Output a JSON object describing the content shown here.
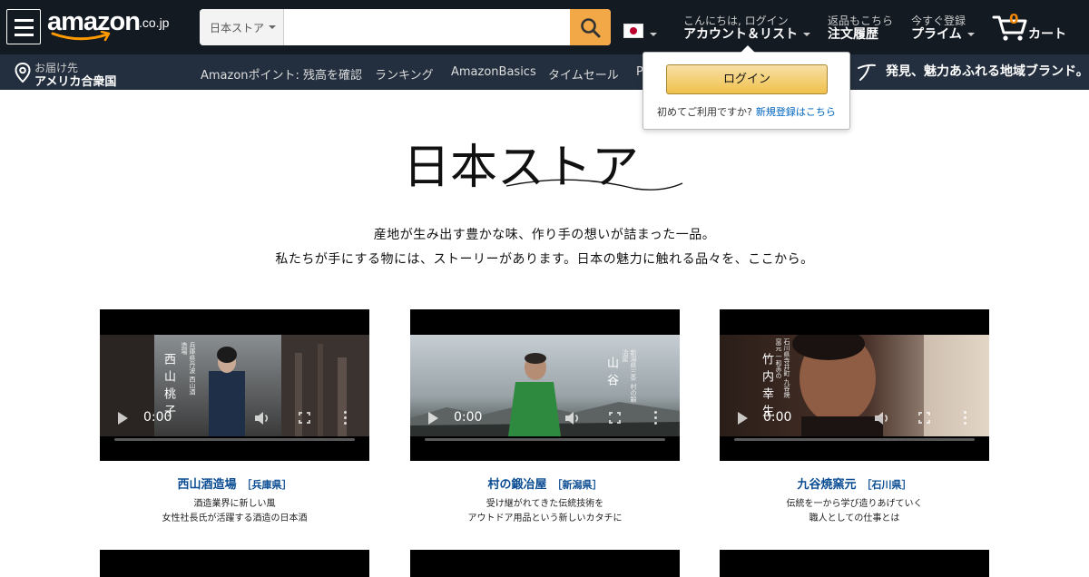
{
  "header": {
    "logo_word": "amazon",
    "logo_suffix": ".co.jp",
    "search": {
      "category": "日本ストア",
      "placeholder": "",
      "value": ""
    },
    "account": {
      "greeting": "こんにちは, ログイン",
      "label": "アカウント＆リスト"
    },
    "orders": {
      "small": "返品もこちら",
      "big": "注文履歴"
    },
    "prime": {
      "small": "今すぐ登録",
      "big": "プライム"
    },
    "cart": {
      "count": "0",
      "label": "カート"
    }
  },
  "subnav": {
    "deliver_small": "お届け先",
    "deliver_big": "アメリカ合衆国",
    "links": [
      "Amazonポイント: 残高を確認",
      "ランキング",
      "AmazonBasics",
      "タイムセール",
      "P"
    ],
    "promo": "発見、魅力あふれる地域ブランド。"
  },
  "flyout": {
    "login_button": "ログイン",
    "first_time": "初めてご利用ですか?",
    "register_link": "新規登録はこちら"
  },
  "hero": {
    "title": "日本ストア",
    "tagline_1": "産地が生み出す豊かな味、作り手の想いが詰まった一品。",
    "tagline_2": "私たちが手にする物には、ストーリーがあります。日本の魅力に触れる品々を、ここから。"
  },
  "cards": [
    {
      "name": "西山酒造場",
      "prefecture": "［兵庫県］",
      "desc_1": "酒造業界に新しい風",
      "desc_2": "女性社長氏が活躍する酒造の日本酒",
      "time": "0:00",
      "overlay_name": "西山桃子",
      "overlay_sub": "兵庫県丹波 西山酒造場"
    },
    {
      "name": "村の鍛冶屋",
      "prefecture": "［新潟県］",
      "desc_1": "受け継がれてきた伝統技術を",
      "desc_2": "アウトドア用品という新しいカタチに",
      "time": "0:00",
      "overlay_name": "山谷",
      "overlay_sub": "新潟県三条 村の鍛冶屋"
    },
    {
      "name": "九谷焼窯元",
      "prefecture": "［石川県］",
      "desc_1": "伝統を一から学び造りあげていく",
      "desc_2": "職人としての仕事とは",
      "time": "0:00",
      "overlay_name": "竹内幸生",
      "overlay_sub": "石川県寺井町 九谷焼窯元 一和赤の"
    }
  ],
  "colors": {
    "nav_top": "#131a22",
    "nav_sub": "#232f3e",
    "search_button": "#f3a847",
    "cart_count": "#f08804",
    "card_title": "#0a4c93",
    "flyout_button": "#f0c14b"
  }
}
